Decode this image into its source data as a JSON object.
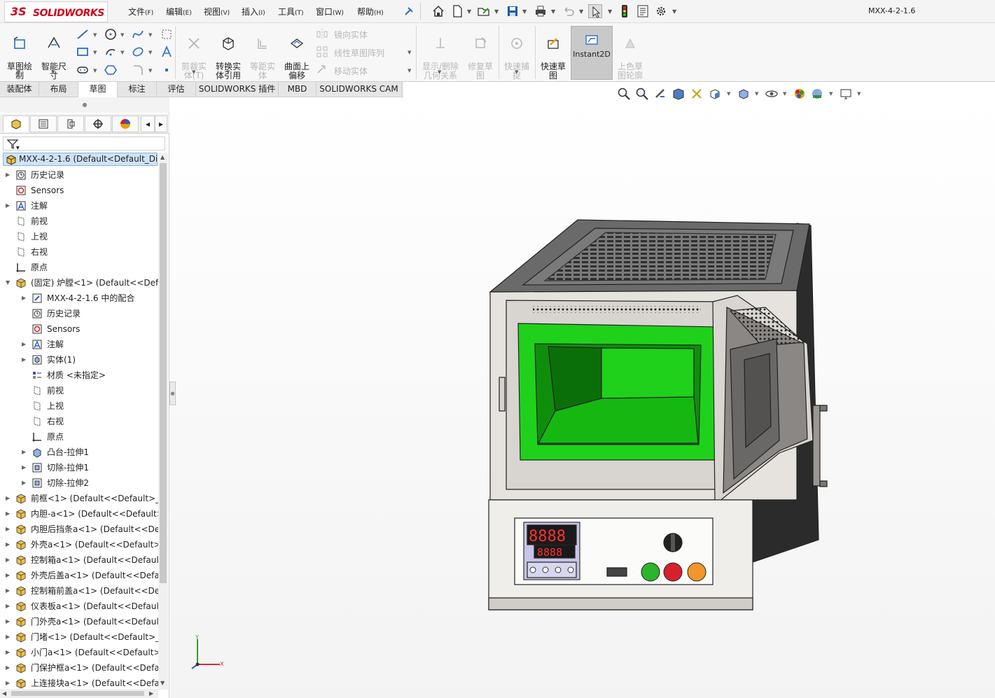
{
  "app": {
    "logo_ds": "3S",
    "logo_text": "SOLIDWORKS",
    "document_title": "MXX-4-2-1.6"
  },
  "menu": [
    {
      "label": "文件",
      "key": "(F)"
    },
    {
      "label": "编辑",
      "key": "(E)"
    },
    {
      "label": "视图",
      "key": "(V)"
    },
    {
      "label": "插入",
      "key": "(I)"
    },
    {
      "label": "工具",
      "key": "(T)"
    },
    {
      "label": "窗口",
      "key": "(W)"
    },
    {
      "label": "帮助",
      "key": "(H)"
    }
  ],
  "ribbon": {
    "sketch": "草图绘\n制",
    "smart_dim": "智能尺\n寸",
    "trim": "剪裁实\n体(T)",
    "convert": "转换实\n体引用",
    "offset": "等距实\n体",
    "surface_offset": "曲面上\n偏移",
    "mirror": "镜向实体",
    "linear_pattern": "线性草图阵列",
    "move": "移动实体",
    "relations": "显示/删除\n几何关系",
    "repair": "修复草\n图",
    "quick_snap": "快速捕\n捉",
    "rapid_sketch": "快速草\n图",
    "instant2d": "Instant2D",
    "shaded_contours": "上色草\n图轮廓"
  },
  "tabs": [
    "装配体",
    "布局",
    "草图",
    "标注",
    "评估",
    "SOLIDWORKS 插件",
    "MBD",
    "SOLIDWORKS CAM"
  ],
  "active_tab": "草图",
  "feature_tree": {
    "root": "MXX-4-2-1.6  (Default<Default_Dis",
    "items": [
      {
        "label": "历史记录",
        "level": 0,
        "expander": true
      },
      {
        "label": "Sensors",
        "level": 0,
        "expander": false
      },
      {
        "label": "注解",
        "level": 0,
        "expander": true
      },
      {
        "label": "前视",
        "level": 0,
        "expander": false
      },
      {
        "label": "上视",
        "level": 0,
        "expander": false
      },
      {
        "label": "右视",
        "level": 0,
        "expander": false
      },
      {
        "label": "原点",
        "level": 0,
        "expander": false
      },
      {
        "label": "(固定) 炉膛<1> (Default<<Defa",
        "level": 0,
        "expander": true,
        "open": true
      },
      {
        "label": "MXX-4-2-1.6 中的配合",
        "level": 1,
        "expander": true
      },
      {
        "label": "历史记录",
        "level": 1,
        "expander": false
      },
      {
        "label": "Sensors",
        "level": 1,
        "expander": false
      },
      {
        "label": "注解",
        "level": 1,
        "expander": true
      },
      {
        "label": "实体(1)",
        "level": 1,
        "expander": true
      },
      {
        "label": "材质 <未指定>",
        "level": 1,
        "expander": false
      },
      {
        "label": "前视",
        "level": 1,
        "expander": false
      },
      {
        "label": "上视",
        "level": 1,
        "expander": false
      },
      {
        "label": "右视",
        "level": 1,
        "expander": false
      },
      {
        "label": "原点",
        "level": 1,
        "expander": false
      },
      {
        "label": "凸台-拉伸1",
        "level": 1,
        "expander": true
      },
      {
        "label": "切除-拉伸1",
        "level": 1,
        "expander": true
      },
      {
        "label": "切除-拉伸2",
        "level": 1,
        "expander": true
      },
      {
        "label": "前框<1> (Default<<Default>_P",
        "level": 0,
        "expander": true
      },
      {
        "label": "内胆-a<1> (Default<<Default>",
        "level": 0,
        "expander": true
      },
      {
        "label": "内胆后挡条a<1> (Default<<De",
        "level": 0,
        "expander": true
      },
      {
        "label": "外壳a<1> (Default<<Default>_",
        "level": 0,
        "expander": true
      },
      {
        "label": "控制箱a<1> (Default<<Default",
        "level": 0,
        "expander": true
      },
      {
        "label": "外壳后盖a<1> (Default<<Defa",
        "level": 0,
        "expander": true
      },
      {
        "label": "控制箱前盖a<1> (Default<<De",
        "level": 0,
        "expander": true
      },
      {
        "label": "仪表板a<1> (Default<<Default",
        "level": 0,
        "expander": true
      },
      {
        "label": "门外壳a<1> (Default<<Default",
        "level": 0,
        "expander": true
      },
      {
        "label": "门堵<1> (Default<<Default>_P",
        "level": 0,
        "expander": true
      },
      {
        "label": "小门a<1> (Default<<Default>_",
        "level": 0,
        "expander": true
      },
      {
        "label": "门保护框a<1> (Default<<Defa",
        "level": 0,
        "expander": true
      },
      {
        "label": "上连接块a<1> (Default<<Defa",
        "level": 0,
        "expander": true
      }
    ]
  },
  "model": {
    "display_top": "8888",
    "display_bottom": "8888",
    "chamber_color": "#1fd11a",
    "body_color": "#e6e3df",
    "button_colors": [
      "#2ab52a",
      "#d8202c",
      "#f0962a"
    ]
  },
  "triad": {
    "x": "X",
    "y": "Y"
  }
}
